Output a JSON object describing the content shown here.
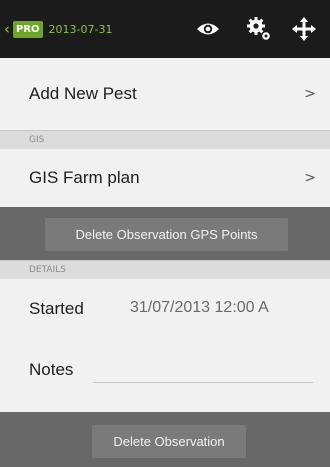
{
  "header": {
    "back_glyph": "‹",
    "pro_badge": "PRO",
    "date": "2013-07-31",
    "icons": [
      "eye-icon",
      "gear-icon",
      "move-icon"
    ]
  },
  "rows": {
    "add_pest": {
      "label": "Add New Pest",
      "chevron": ">"
    },
    "gis_farm_plan": {
      "label": "GIS Farm plan",
      "chevron": ">"
    }
  },
  "sections": {
    "gis": "GIS",
    "details": "DETAILS"
  },
  "buttons": {
    "delete_gps": "Delete Observation GPS Points",
    "delete_observation": "Delete Observation"
  },
  "details": {
    "started_label": "Started",
    "started_value": "31/07/2013 12:00 A",
    "notes_label": "Notes",
    "notes_value": ""
  },
  "colors": {
    "accent_green": "#8ac43f",
    "topbar": "#1b1b1b",
    "band": "#686868"
  }
}
